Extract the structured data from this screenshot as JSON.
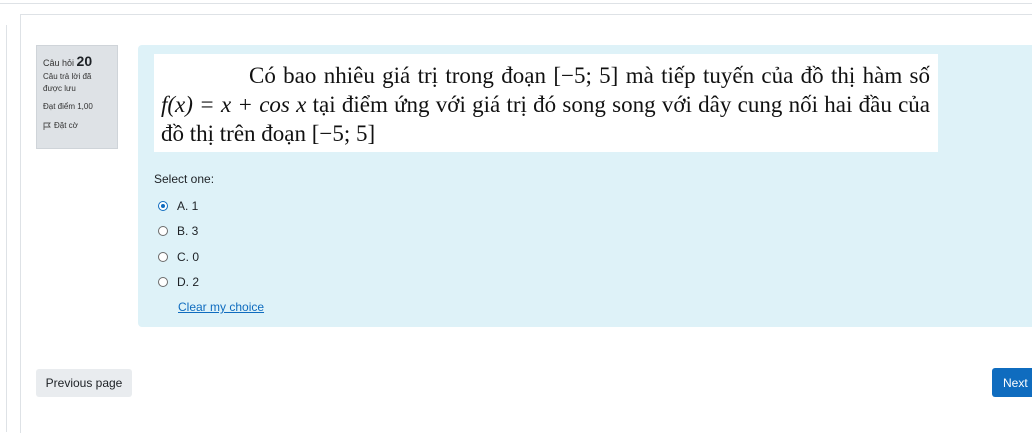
{
  "question_info": {
    "label": "Câu hỏi",
    "number": "20",
    "state": "Câu trả lời đã được lưu",
    "grade": "Đạt điểm 1,00",
    "flag_label": "Đặt cờ",
    "flag_icon": "flag-icon"
  },
  "question": {
    "line1_text": "Có bao nhiêu giá trị trong đoạn",
    "interval_1": "[−5; 5]",
    "line1_tail": "mà tiếp tuyến của đồ thị",
    "line2_head": "hàm số",
    "function": "f(x) = x + cos x",
    "line2_tail": "tại điểm ứng với giá trị đó song song với dây cung",
    "line3_head": "nối hai đầu của đồ thị trên đoạn",
    "interval_2": "[−5; 5]"
  },
  "prompt": "Select one:",
  "options": [
    {
      "label": "A. 1",
      "selected": true
    },
    {
      "label": "B. 3",
      "selected": false
    },
    {
      "label": "C. 0",
      "selected": false
    },
    {
      "label": "D. 2",
      "selected": false
    }
  ],
  "clear_label": "Clear my choice",
  "nav": {
    "previous_label": "Previous page",
    "next_label": "Next"
  },
  "colors": {
    "accent": "#0f6cbf",
    "formulation_bg": "#def2f8",
    "info_bg": "#dee2e6"
  }
}
